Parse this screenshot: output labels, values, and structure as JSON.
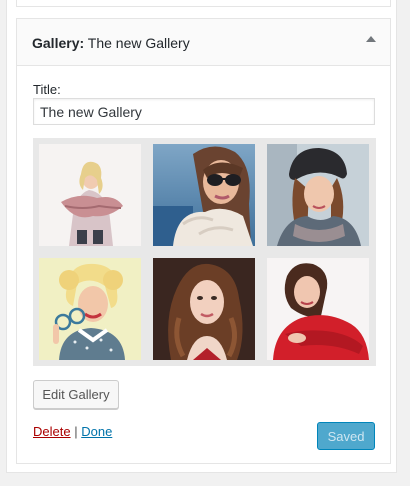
{
  "widget": {
    "type_label": "Gallery:",
    "title": "The new Gallery",
    "toggle_icon": "triangle-up-icon"
  },
  "form": {
    "title_label": "Title:",
    "title_value": "The new Gallery"
  },
  "gallery": {
    "images": [
      {
        "name": "woman-with-scarf-photo"
      },
      {
        "name": "woman-with-sunglasses-photo"
      },
      {
        "name": "woman-with-beanie-photo"
      },
      {
        "name": "retro-woman-with-glasses-photo"
      },
      {
        "name": "woman-with-curly-hair-photo"
      },
      {
        "name": "woman-in-red-sweater-photo"
      }
    ]
  },
  "actions": {
    "edit_gallery": "Edit Gallery",
    "delete": "Delete",
    "separator": "|",
    "done": "Done",
    "saved": "Saved"
  },
  "colors": {
    "link": "#0073aa",
    "delete_link": "#a00000",
    "primary_button": "#4fa8cd"
  }
}
